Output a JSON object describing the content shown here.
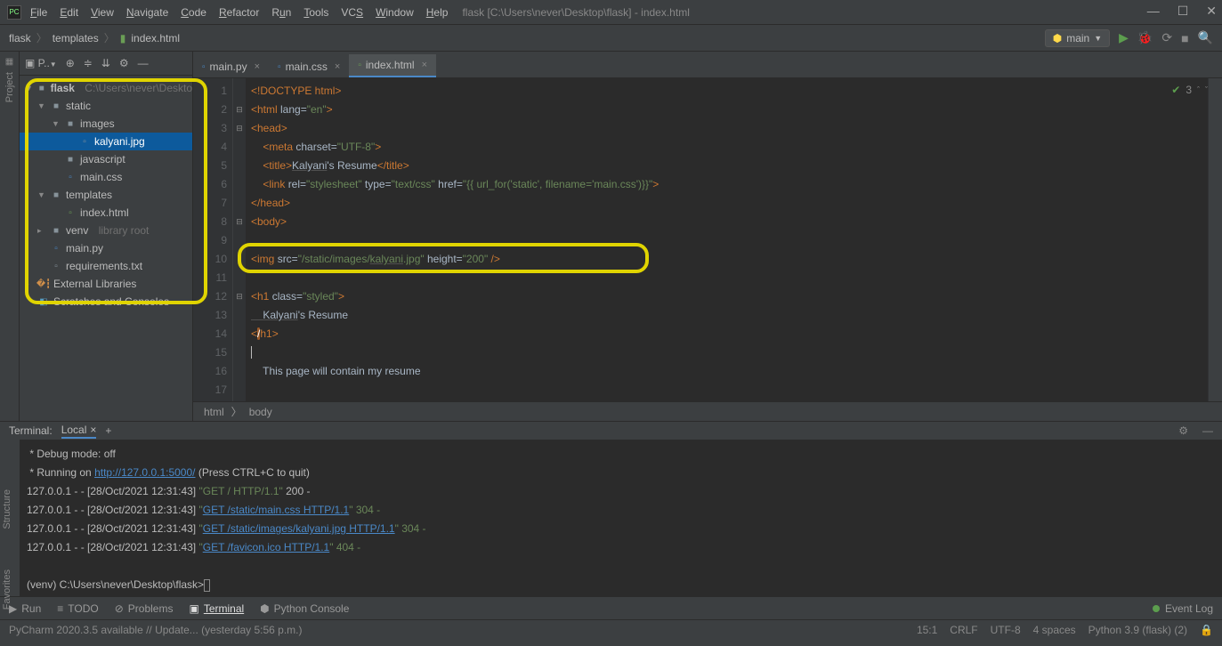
{
  "window": {
    "title": "flask [C:\\Users\\never\\Desktop\\flask] - index.html",
    "menu": [
      "File",
      "Edit",
      "View",
      "Navigate",
      "Code",
      "Refactor",
      "Run",
      "Tools",
      "VCS",
      "Window",
      "Help"
    ]
  },
  "breadcrumb": {
    "root": "flask",
    "mid": "templates",
    "file": "index.html"
  },
  "run_config": "main",
  "project_label": "Project",
  "tree": {
    "root": "flask",
    "root_path": "C:\\Users\\never\\Deskto",
    "static": "static",
    "images": "images",
    "kalyani": "kalyani.jpg",
    "javascript": "javascript",
    "maincss": "main.css",
    "templates": "templates",
    "indexhtml": "index.html",
    "venv": "venv",
    "venv_note": "library root",
    "mainpy": "main.py",
    "requirements": "requirements.txt",
    "extlib": "External Libraries",
    "scratch": "Scratches and Consoles"
  },
  "tabs": [
    {
      "label": "main.py"
    },
    {
      "label": "main.css"
    },
    {
      "label": "index.html"
    }
  ],
  "inspect": {
    "count": "3"
  },
  "code": {
    "l1": "<!DOCTYPE html>",
    "l2a": "<html ",
    "l2b": "lang=",
    "l2c": "\"en\"",
    "l2d": ">",
    "l3": "<head>",
    "l4a": "    <meta ",
    "l4b": "charset=",
    "l4c": "\"UTF-8\"",
    "l4d": ">",
    "l5a": "    <title>",
    "l5b": "Kalyani",
    "l5c": "'s Resume",
    "l5d": "</title>",
    "l6a": "    <link ",
    "l6b": "rel=",
    "l6c": "\"stylesheet\" ",
    "l6d": "type=",
    "l6e": "\"text/css\" ",
    "l6f": "href=",
    "l6g": "\"{{ url_for('static', filename='main.css')}}\"",
    "l6h": ">",
    "l7": "</head>",
    "l8": "<body>",
    "l10a": "<img ",
    "l10b": "src=",
    "l10c": "\"/static/images/",
    "l10d": "kalyani",
    "l10e": ".jpg\" ",
    "l10f": "height=",
    "l10g": "\"200\" ",
    "l10h": "/>",
    "l12a": "<h1 ",
    "l12b": "class=",
    "l12c": "\"styled\"",
    "l12d": ">",
    "l13a": "    Kalyani",
    "l13b": "'s Resume",
    "l14a": "<",
    "l14b": "h1>",
    "l16": "    This page will contain my resume"
  },
  "breadcrumb2": {
    "a": "html",
    "b": "body"
  },
  "terminal": {
    "title": "Terminal:",
    "local": "Local",
    "l1": " * Debug mode: off",
    "l2a": " * Running on ",
    "l2b": "http://127.0.0.1:5000/",
    "l2c": " (Press CTRL+C to quit)",
    "l3a": "127.0.0.1 - - [28/Oct/2021 12:31:43] ",
    "l3b": "\"GET / HTTP/1.1\" ",
    "l3c": "200 -",
    "l4a": "127.0.0.1 - - [28/Oct/2021 12:31:43] ",
    "l4b": "\"",
    "l4c": "GET /static/main.css HTTP/1.1",
    "l4d": "\" 304 -",
    "l5a": "127.0.0.1 - - [28/Oct/2021 12:31:43] ",
    "l5b": "\"",
    "l5c": "GET /static/images/kalyani.jpg HTTP/1.1",
    "l5d": "\" 304 -",
    "l6a": "127.0.0.1 - - [28/Oct/2021 12:31:43] ",
    "l6b": "\"",
    "l6c": "GET /favicon.ico HTTP/1.1",
    "l6d": "\" 404 -",
    "prompt": "(venv) C:\\Users\\never\\Desktop\\flask>"
  },
  "bottom": {
    "run": "Run",
    "todo": "TODO",
    "problems": "Problems",
    "terminal": "Terminal",
    "pyconsole": "Python Console",
    "event": "Event Log"
  },
  "status": {
    "left": "PyCharm 2020.3.5 available // Update... (yesterday 5:56 p.m.)",
    "pos": "15:1",
    "eol": "CRLF",
    "enc": "UTF-8",
    "indent": "4 spaces",
    "interp": "Python 3.9 (flask) (2)"
  },
  "side_tabs": {
    "structure": "Structure",
    "favorites": "Favorites"
  }
}
